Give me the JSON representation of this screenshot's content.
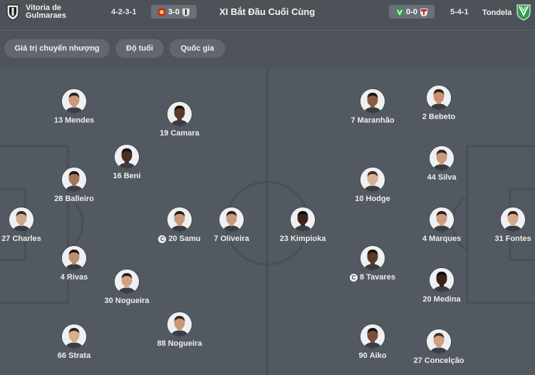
{
  "header": {
    "home_team": "Vitoria de Gulmaraes",
    "home_formation": "4-2-3-1",
    "home_last_score": "3-0",
    "title": "XI Bắt Đầu Cuối Cùng",
    "away_last_score": "0-0",
    "away_formation": "5-4-1",
    "away_team": "Tondela"
  },
  "filters": [
    "Giá trị chuyển nhượng",
    "Độ tuổi",
    "Quốc gia"
  ],
  "home_players": [
    {
      "number": "13",
      "name": "Mendes",
      "captain": false,
      "skin": "#c99a7a",
      "hair": "#2a2421"
    },
    {
      "number": "19",
      "name": "Camara",
      "captain": false,
      "skin": "#5a3a28",
      "hair": "#1a1410"
    },
    {
      "number": "16",
      "name": "Beni",
      "captain": false,
      "skin": "#4a2e20",
      "hair": "#141010"
    },
    {
      "number": "28",
      "name": "Balleiro",
      "captain": false,
      "skin": "#a87458",
      "hair": "#1c1612"
    },
    {
      "number": "27",
      "name": "Charles",
      "captain": false,
      "skin": "#d2a88a",
      "hair": "#3a2e22"
    },
    {
      "number": "20",
      "name": "Samu",
      "captain": true,
      "skin": "#c89878",
      "hair": "#241c16"
    },
    {
      "number": "7",
      "name": "Oliveira",
      "captain": false,
      "skin": "#c89a7c",
      "hair": "#2c221c"
    },
    {
      "number": "4",
      "name": "Rivas",
      "captain": false,
      "skin": "#c0906e",
      "hair": "#1e1812"
    },
    {
      "number": "30",
      "name": "Nogueira",
      "captain": false,
      "skin": "#d0a282",
      "hair": "#2a2018"
    },
    {
      "number": "88",
      "name": "Nogueira",
      "captain": false,
      "skin": "#c8987a",
      "hair": "#3a2a1e"
    },
    {
      "number": "66",
      "name": "Strata",
      "captain": false,
      "skin": "#d6ae90",
      "hair": "#2e241c"
    }
  ],
  "away_players": [
    {
      "number": "7",
      "name": "Maranhão",
      "captain": false,
      "skin": "#8a5c40",
      "hair": "#1a1410"
    },
    {
      "number": "2",
      "name": "Bebeto",
      "captain": false,
      "skin": "#c89070",
      "hair": "#2a1e16"
    },
    {
      "number": "44",
      "name": "Silva",
      "captain": false,
      "skin": "#c99a7c",
      "hair": "#2e241c"
    },
    {
      "number": "10",
      "name": "Hodge",
      "captain": false,
      "skin": "#d8b094",
      "hair": "#3a2c20"
    },
    {
      "number": "23",
      "name": "Kimpioka",
      "captain": false,
      "skin": "#3e2418",
      "hair": "#100c0a"
    },
    {
      "number": "4",
      "name": "Marques",
      "captain": false,
      "skin": "#cc9c7e",
      "hair": "#2a2018"
    },
    {
      "number": "31",
      "name": "Fontes",
      "captain": false,
      "skin": "#d4a888",
      "hair": "#322418"
    },
    {
      "number": "8",
      "name": "Tavares",
      "captain": true,
      "skin": "#5a3828",
      "hair": "#141010"
    },
    {
      "number": "20",
      "name": "Medina",
      "captain": false,
      "skin": "#3a2216",
      "hair": "#0e0a08"
    },
    {
      "number": "90",
      "name": "Aiko",
      "captain": false,
      "skin": "#7a4e36",
      "hair": "#181210"
    },
    {
      "number": "27",
      "name": "Concelção",
      "captain": false,
      "skin": "#d0a080",
      "hair": "#4a3624"
    }
  ],
  "colors": {
    "home_primary": "#1a1a1a",
    "away_primary": "#2e9e4a",
    "away_secondary": "#e8e8e8",
    "captain_badge": "#f2f2f2"
  }
}
